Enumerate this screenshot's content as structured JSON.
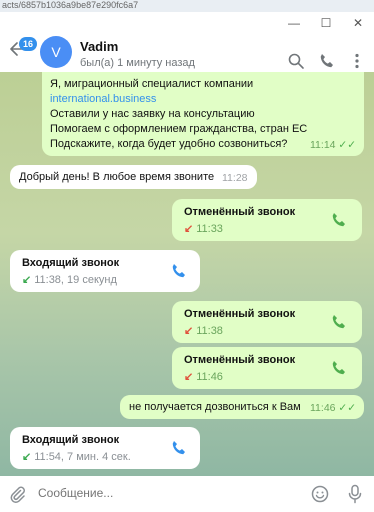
{
  "browser": {
    "url_fragment": "acts/6857b1036a9be87e290fc6a7"
  },
  "window": {
    "minimize": "—",
    "maximize": "☐",
    "close": "✕"
  },
  "header": {
    "badge": "16",
    "avatar_letter": "V",
    "name": "Vadim",
    "status": "был(а) 1 минуту назад"
  },
  "messages": {
    "first": {
      "line1": "Я, миграционный специалист компании",
      "link": "international.business",
      "line3": "Оставили у нас заявку на консультацию",
      "line4": "Помогаем с оформлением гражданства, стран ЕС",
      "line5": "Подскажите, когда будет удобно созвониться?",
      "time": "11:14",
      "ticks": "✓✓"
    },
    "reply": {
      "text": "Добрый день! В любое время звоните",
      "time": "11:28"
    },
    "call1": {
      "title": "Отменённый звонок",
      "sub": "11:33"
    },
    "call2": {
      "title": "Входящий звонок",
      "sub": "11:38, 19 секунд"
    },
    "call3": {
      "title": "Отменённый звонок",
      "sub": "11:38"
    },
    "call4": {
      "title": "Отменённый звонок",
      "sub": "11:46"
    },
    "text2": {
      "text": "не получается дозвониться к Вам",
      "time": "11:46",
      "ticks": "✓✓"
    },
    "call5": {
      "title": "Входящий звонок",
      "sub": "11:54, 7 мин. 4 сек."
    }
  },
  "composer": {
    "placeholder": "Сообщение..."
  },
  "colors": {
    "accent": "#3390ec",
    "outgoing": "#e1fec6",
    "incoming": "#ffffff",
    "missed": "#e0523c",
    "received": "#3aa94f"
  },
  "icons": [
    "back-arrow-icon",
    "search-icon",
    "phone-icon",
    "more-vertical-icon",
    "attach-icon",
    "emoji-icon",
    "microphone-icon"
  ]
}
